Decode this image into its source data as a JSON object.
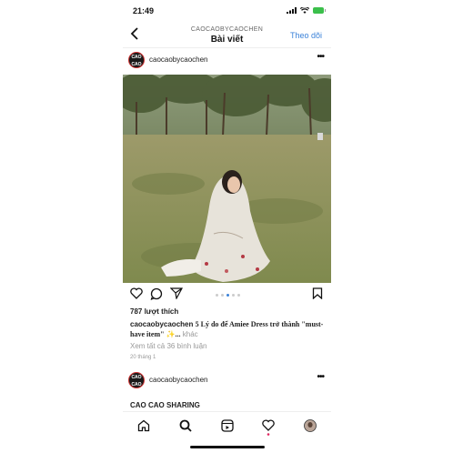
{
  "status": {
    "time": "21:49"
  },
  "header": {
    "subtitle": "CAOCAOBYCAOCHEN",
    "title": "Bài viết",
    "follow_label": "Theo dõi"
  },
  "post": {
    "username": "caocaobycaochen",
    "avatar_text": "CAO CAO",
    "likes": "787 lượt thích",
    "caption_user": "caocaobycaochen",
    "caption_text": "5 Lý do để Amiee Dress trở thành \"must-have item\" ✨...",
    "caption_more": "khác",
    "comments": "Xem tất cả 36 bình luận",
    "date": "20 tháng 1",
    "carousel": {
      "count": 5,
      "active": 2
    }
  },
  "post2": {
    "username": "caocaobycaochen",
    "avatar_text": "CAO CAO",
    "preview": "CAO CAO SHARING"
  },
  "tabbar": {
    "items": [
      "home-icon",
      "search-icon",
      "reels-icon",
      "heart-icon",
      "profile-avatar"
    ],
    "notification_color": "#e0245e"
  },
  "colors": {
    "accent": "#3b82d9"
  }
}
